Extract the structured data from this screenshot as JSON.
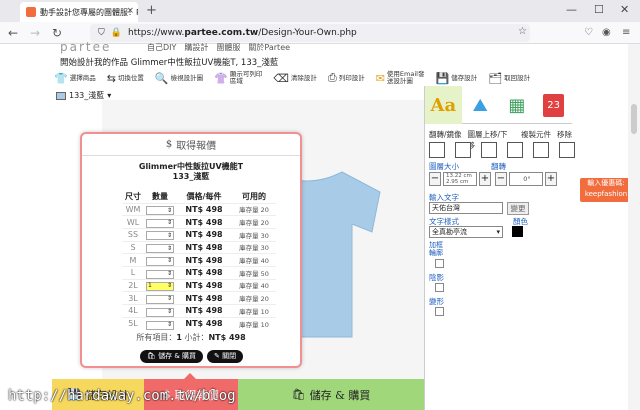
{
  "browser": {
    "tab_title": "動手設計您專屬的團體服！Partee",
    "url_prefix": "https://www.",
    "url_host": "partee.com.tw",
    "url_path": "/Design-Your-Own.php",
    "tab_close": "×",
    "new_tab": "+",
    "minimize": "—",
    "maximize": "☐",
    "close": "✕"
  },
  "site": {
    "brand": "partee",
    "nav": [
      "自己DIY",
      "購設計",
      "團體服",
      "關於Partee"
    ],
    "page_title": "開始設計我的作品 Glimmer中性飯拉UV機能T, 133_淺藍",
    "tools": [
      "選擇商品",
      "切換位置",
      "檢視設計圖",
      "顯示可列印\n區域",
      "清除設計",
      "列印設計",
      "使用Email發\n送設計圖",
      "儲存設計",
      "取回設計"
    ],
    "color_label": "133_淺藍",
    "color_hex": "#a8cce8"
  },
  "panel": {
    "tabs": [
      "Aa",
      "⛰",
      "▦",
      "23"
    ],
    "row_labels": [
      "翻轉/鏡像",
      "圖層上移/下移",
      "複製元件",
      "移除"
    ],
    "size_label": "圖層大小",
    "rotate_label": "翻轉",
    "size_value_1": "13.22 cm",
    "size_value_2": "2.95 cm",
    "rotate_value": "0°",
    "text_label": "輸入文字",
    "text_value": "天佑台灣",
    "change_button": "變更",
    "font_label": "文字樣式",
    "color_label": "顏色",
    "font_value": "全真勘亭流",
    "outline_label": "加框輪廓",
    "shadow_label": "陰影",
    "arc_label": "變形"
  },
  "promo": {
    "line1": "輸入優惠碼:",
    "line2": "keepfashion"
  },
  "modal": {
    "title": "取得報價",
    "product_line1": "Glimmer中性飯拉UV機能T",
    "product_line2": "133_淺藍",
    "headers": [
      "尺寸",
      "數量",
      "價格/每件",
      "可用的"
    ],
    "rows": [
      {
        "size": "WM",
        "qty": "",
        "price": "NT$ 498",
        "stock": "庫存量 20"
      },
      {
        "size": "WL",
        "qty": "",
        "price": "NT$ 498",
        "stock": "庫存量 20"
      },
      {
        "size": "SS",
        "qty": "",
        "price": "NT$ 498",
        "stock": "庫存量 30"
      },
      {
        "size": "S",
        "qty": "",
        "price": "NT$ 498",
        "stock": "庫存量 30"
      },
      {
        "size": "M",
        "qty": "",
        "price": "NT$ 498",
        "stock": "庫存量 40"
      },
      {
        "size": "L",
        "qty": "",
        "price": "NT$ 498",
        "stock": "庫存量 50"
      },
      {
        "size": "2L",
        "qty": "1",
        "price": "NT$ 498",
        "stock": "庫存量 40"
      },
      {
        "size": "3L",
        "qty": "",
        "price": "NT$ 498",
        "stock": "庫存量 20"
      },
      {
        "size": "4L",
        "qty": "",
        "price": "NT$ 498",
        "stock": "庫存量 10"
      },
      {
        "size": "5L",
        "qty": "",
        "price": "NT$ 498",
        "stock": "庫存量 10"
      }
    ],
    "summary_label": "所有項目：",
    "summary_count": "1",
    "summary_sub": "小計：",
    "summary_total": "NT$ 498",
    "btn_save_buy": "儲存 & 購買",
    "btn_close": "關閉"
  },
  "bottom": {
    "save": "儲存設計",
    "quote": "取得報價",
    "save_buy": "儲存 & 購買"
  },
  "watermark": "http://hardaway.com.tw/blog"
}
